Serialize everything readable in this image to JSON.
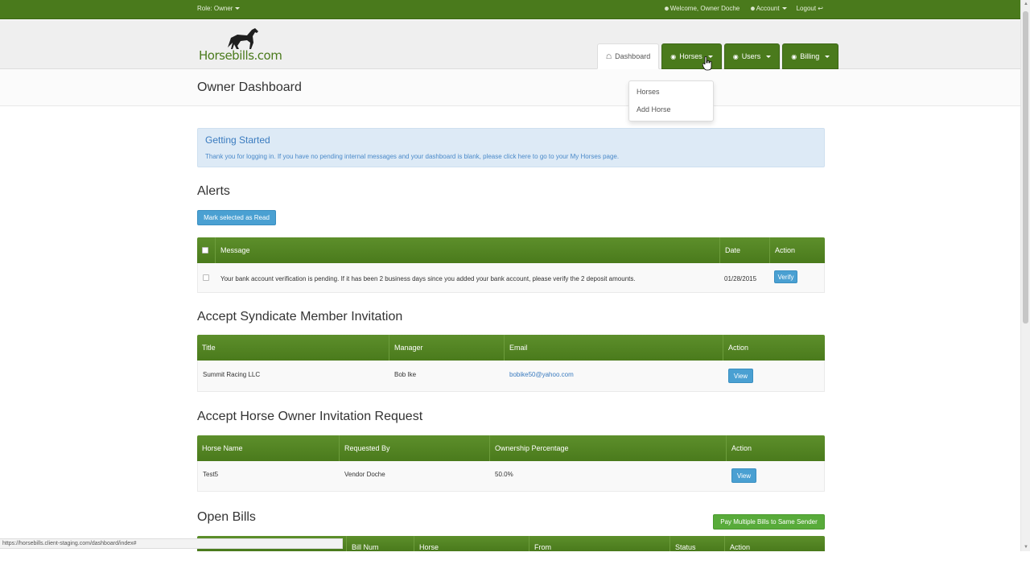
{
  "topbar": {
    "role": "Role: Owner",
    "welcome": "Welcome, Owner Doche",
    "account": "Account",
    "logout": "Logout"
  },
  "logo": {
    "text": "Horsebills.com"
  },
  "nav": {
    "dashboard": "Dashboard",
    "horses": "Horses",
    "users": "Users",
    "billing": "Billing"
  },
  "horses_menu": {
    "items": [
      "Horses",
      "Add Horse"
    ]
  },
  "page_title": "Owner Dashboard",
  "getting_started": {
    "title": "Getting Started",
    "text": "Thank you for logging in. If you have no pending internal messages and your dashboard is blank, please click here to go to your My Horses page."
  },
  "alerts": {
    "heading": "Alerts",
    "mark_read_button": "Mark selected as Read",
    "columns": {
      "message": "Message",
      "date": "Date",
      "action": "Action"
    },
    "rows": [
      {
        "message": "Your bank account verification is pending. If it has been 2 business days since you added your bank account, please verify the 2 deposit amounts.",
        "date": "01/28/2015",
        "action": "Verify"
      }
    ]
  },
  "syndicate": {
    "heading": "Accept Syndicate Member Invitation",
    "columns": {
      "title": "Title",
      "manager": "Manager",
      "email": "Email",
      "action": "Action"
    },
    "rows": [
      {
        "title": "Summit Racing LLC",
        "manager": "Bob Ike",
        "email": "bobike50@yahoo.com",
        "action": "View"
      }
    ]
  },
  "horse_owner": {
    "heading": "Accept Horse Owner Invitation Request",
    "columns": {
      "horse_name": "Horse Name",
      "requested_by": "Requested By",
      "ownership": "Ownership Percentage",
      "action": "Action"
    },
    "rows": [
      {
        "horse_name": "Test5",
        "requested_by": "Vendor Doche",
        "ownership": "50.0%",
        "action": "View"
      }
    ]
  },
  "open_bills": {
    "heading": "Open Bills",
    "pay_button": "Pay Multiple Bills to Same Sender",
    "columns": {
      "bill_num": "Bill Num",
      "horse": "Horse",
      "from": "From",
      "status": "Status",
      "action": "Action"
    }
  },
  "statusbar": {
    "url": "https://horsebills.client-staging.com/dashboard/index#"
  },
  "colors": {
    "brand_green": "#4a7a1c",
    "button_blue": "#4aa0d2",
    "button_green": "#58ab3a",
    "info_bg": "#ddeaf6"
  }
}
